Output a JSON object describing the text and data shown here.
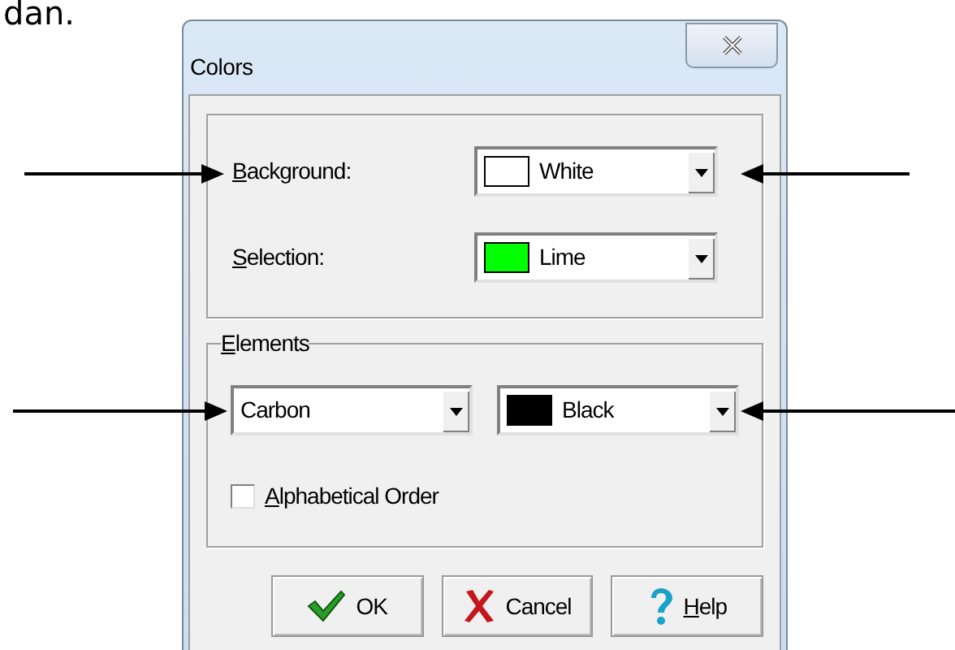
{
  "caption_fragment": "dan.",
  "window": {
    "title": "Colors"
  },
  "colors_group": {
    "rows": [
      {
        "access_key": "B",
        "label_rest": "ackground:",
        "value": "White",
        "color": "#ffffff"
      },
      {
        "access_key": "S",
        "label_rest": "election:",
        "value": "Lime",
        "color": "#00ff00"
      }
    ]
  },
  "elements_group": {
    "access_key": "E",
    "title_rest": "lements",
    "element": "Carbon",
    "color_value": "Black",
    "color": "#000000",
    "checkbox": {
      "access_key": "A",
      "label_rest": "lphabetical Order",
      "checked": false
    }
  },
  "buttons": [
    {
      "kind": "ok",
      "label": "OK"
    },
    {
      "kind": "cancel",
      "label": "Cancel"
    },
    {
      "kind": "help",
      "access_key": "H",
      "label_rest": "elp"
    }
  ]
}
